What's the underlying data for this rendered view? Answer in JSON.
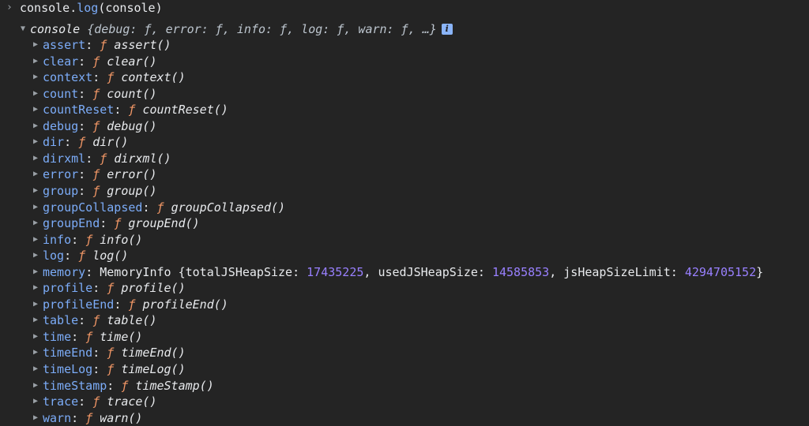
{
  "command": {
    "prompt": "›",
    "text_before": "console.",
    "fn": "log",
    "text_after": "(console)"
  },
  "object": {
    "name": "console",
    "preview": "{debug: ƒ, error: ƒ, info: ƒ, log: ƒ, warn: ƒ, …}",
    "info_icon": "i"
  },
  "props": [
    {
      "key": "assert",
      "fname": "assert()"
    },
    {
      "key": "clear",
      "fname": "clear()"
    },
    {
      "key": "context",
      "fname": "context()"
    },
    {
      "key": "count",
      "fname": "count()"
    },
    {
      "key": "countReset",
      "fname": "countReset()"
    },
    {
      "key": "debug",
      "fname": "debug()"
    },
    {
      "key": "dir",
      "fname": "dir()"
    },
    {
      "key": "dirxml",
      "fname": "dirxml()"
    },
    {
      "key": "error",
      "fname": "error()"
    },
    {
      "key": "group",
      "fname": "group()"
    },
    {
      "key": "groupCollapsed",
      "fname": "groupCollapsed()"
    },
    {
      "key": "groupEnd",
      "fname": "groupEnd()"
    },
    {
      "key": "info",
      "fname": "info()"
    },
    {
      "key": "log",
      "fname": "log()"
    },
    {
      "key": "memory",
      "memory": true,
      "type": "MemoryInfo",
      "k1": "totalJSHeapSize",
      "v1": "17435225",
      "k2": "usedJSHeapSize",
      "v2": "14585853",
      "k3": "jsHeapSizeLimit",
      "v3": "4294705152"
    },
    {
      "key": "profile",
      "fname": "profile()"
    },
    {
      "key": "profileEnd",
      "fname": "profileEnd()"
    },
    {
      "key": "table",
      "fname": "table()"
    },
    {
      "key": "time",
      "fname": "time()"
    },
    {
      "key": "timeEnd",
      "fname": "timeEnd()"
    },
    {
      "key": "timeLog",
      "fname": "timeLog()"
    },
    {
      "key": "timeStamp",
      "fname": "timeStamp()"
    },
    {
      "key": "trace",
      "fname": "trace()"
    },
    {
      "key": "warn",
      "fname": "warn()"
    }
  ],
  "symbols": {
    "f": "ƒ",
    "open": "▼",
    "closed": "▶"
  },
  "colors": {
    "background": "#242424",
    "key": "#7cacf8",
    "function_symbol": "#f29766",
    "number": "#9980ff",
    "info_badge": "#8ab4f8"
  }
}
